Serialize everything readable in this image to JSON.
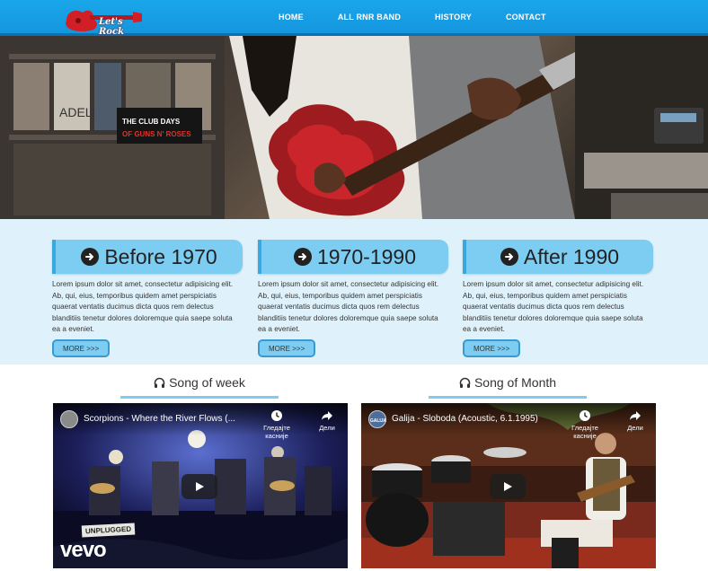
{
  "nav": {
    "logo_text": "Let's Rock",
    "links": [
      "HOME",
      "ALL RNR BAND",
      "HISTORY",
      "CONTACT"
    ]
  },
  "hero": {
    "slides": 3,
    "active_slide": 1,
    "sign_text": "THE CLUB DAYS OF GUNS N' ROSES",
    "poster_text": "ADELE"
  },
  "eras": [
    {
      "title": "Before 1970",
      "text": "Lorem ipsum dolor sit amet, consectetur adipisicing elit. Ab, qui, eius, temporibus quidem amet perspiciatis quaerat ventatis ducimus dicta quos rem delectus blanditiis tenetur dolores doloremque quia saepe soluta ea a eveniet.",
      "button": "MORE >>>"
    },
    {
      "title": "1970-1990",
      "text": "Lorem ipsum dolor sit amet, consectetur adipisicing elit. Ab, qui, eius, temporibus quidem amet perspiciatis quaerat ventatis ducimus dicta quos rem delectus blanditiis tenetur dolores doloremque quia saepe soluta ea a eveniet.",
      "button": "MORE >>>"
    },
    {
      "title": "After 1990",
      "text": "Lorem ipsum dolor sit amet, consectetur adipisicing elit. Ab, qui, eius, temporibus quidem amet perspiciatis quaerat ventatis ducimus dicta quos rem delectus blanditiis tenetur dolores doloremque quia saepe soluta ea a eveniet.",
      "button": "MORE >>>"
    }
  ],
  "songs": [
    {
      "heading": "Song of week",
      "video_title": "Scorpions - Where the River Flows (...",
      "watch_later": "Гледајте касније",
      "share": "Дели",
      "brand": "vevo",
      "stage_text": "UNPLUGGED"
    },
    {
      "heading": "Song of Month",
      "video_title": "Galija - Sloboda (Acoustic, 6.1.1995)",
      "watch_later": "Гледајте касније",
      "share": "Дели",
      "channel_label": "GALIJA"
    }
  ],
  "colors": {
    "nav_bg": "#1aa6ea",
    "accent": "#7dcdf2",
    "section_bg": "#dff2fc"
  }
}
